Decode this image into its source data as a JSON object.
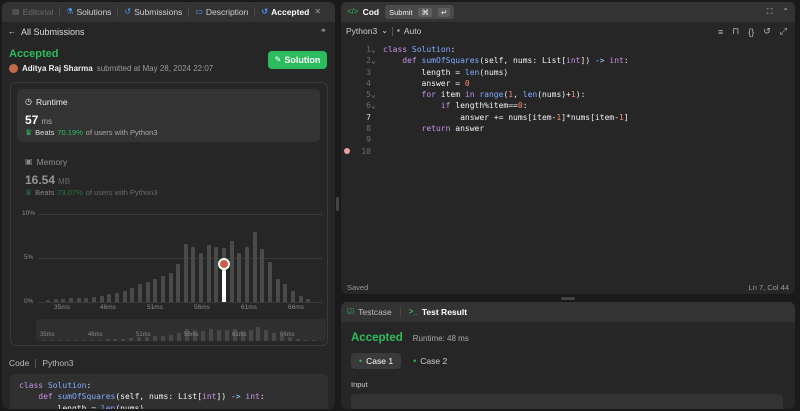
{
  "left_panel": {
    "tabs": [
      {
        "label": "Editorial",
        "icon": "book-icon",
        "state": "dim"
      },
      {
        "label": "Solutions",
        "icon": "flask-icon",
        "state": "normal"
      },
      {
        "label": "Submissions",
        "icon": "history-icon",
        "state": "normal"
      },
      {
        "label": "Description",
        "icon": "document-icon",
        "state": "normal"
      },
      {
        "label": "Accepted",
        "icon": "history-icon",
        "state": "active"
      }
    ],
    "back_label": "All Submissions",
    "status": "Accepted",
    "author": "Aditya Raj Sharma",
    "submitted_text": "submitted at May 28, 2024 22:07",
    "solution_button": "Solution",
    "runtime": {
      "title": "Runtime",
      "value": "57",
      "unit": "ms",
      "beats_label": "Beats",
      "beats_pct": "70.19%",
      "beats_suffix": "of users with Python3"
    },
    "memory": {
      "title": "Memory",
      "value": "16.54",
      "unit": "MB",
      "beats_label": "Beats",
      "beats_pct": "73.07%",
      "beats_suffix": "of users with Python3"
    },
    "code_section": {
      "label": "Code",
      "language": "Python3",
      "lines": [
        "class Solution:",
        "    def sumOfSquares(self, nums: List[int]) -> int:",
        "        length = len(nums)"
      ]
    }
  },
  "chart_data": {
    "type": "bar",
    "ylim": [
      0,
      10
    ],
    "yticks": [
      "10%",
      "5%",
      "0%"
    ],
    "xticks": [
      "35ms",
      "46ms",
      "51ms",
      "56ms",
      "61ms",
      "66ms"
    ],
    "mini_xticks": [
      "35ms",
      "46ms",
      "51ms",
      "56ms",
      "61ms",
      "66ms"
    ],
    "values": [
      0.2,
      0.3,
      0.3,
      0.4,
      0.4,
      0.5,
      0.6,
      0.7,
      0.9,
      1.0,
      1.3,
      1.6,
      2.0,
      2.3,
      2.6,
      2.9,
      3.3,
      4.3,
      6.6,
      6.3,
      5.6,
      6.5,
      6.3,
      6.1,
      6.9,
      5.6,
      6.3,
      7.9,
      6.0,
      4.6,
      2.6,
      2.0,
      1.3,
      0.7,
      0.3
    ],
    "highlight_index": 23,
    "highlight_value": 3.6
  },
  "editor": {
    "title": "Cod",
    "submit_label": "Submit",
    "language": "Python3",
    "mode": "Auto",
    "status": "Saved",
    "cursor": "Ln 7, Col 44",
    "line_numbers": [
      "1",
      "2",
      "3",
      "4",
      "5",
      "6",
      "7",
      "8",
      "9",
      "10"
    ],
    "code_lines": [
      "class Solution:",
      "    def sumOfSquares(self, nums: List[int]) -> int:",
      "        length = len(nums)",
      "        answer = 0",
      "        for item in range(1, len(nums)+1):",
      "            if length%item==0:",
      "                answer += nums[item-1]*nums[item-1]",
      "        return answer",
      "",
      ""
    ]
  },
  "bottom_panel": {
    "tabs": [
      {
        "label": "Testcase",
        "icon": "checkbox-icon"
      },
      {
        "label": "Test Result",
        "icon": "terminal-icon"
      }
    ],
    "result": "Accepted",
    "runtime": "Runtime: 48 ms",
    "cases": [
      "Case 1",
      "Case 2"
    ],
    "input_label": "Input"
  },
  "colors": {
    "accepted": "#2cbb5d",
    "beats": "#2cbb5d",
    "panel": "#262626",
    "card": "#333333"
  }
}
